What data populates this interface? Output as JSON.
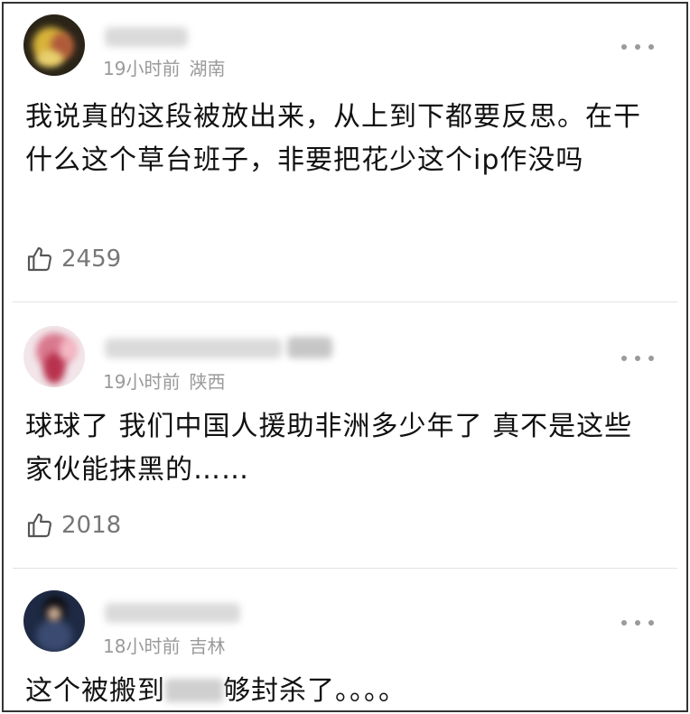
{
  "comments": [
    {
      "time": "19小时前",
      "location": "湖南",
      "text": "我说真的这段被放出来，从上到下都要反思。在干什么这个草台班子，非要把花少这个ip作没吗",
      "likes": "2459",
      "avatar_icon": "user-avatar-blurred",
      "more_icon": "more-dots-icon",
      "like_icon": "thumbs-up-icon"
    },
    {
      "time": "19小时前",
      "location": "陕西",
      "text": "球球了  我们中国人援助非洲多少年了 真不是这些家伙能抹黑的……",
      "likes": "2018",
      "avatar_icon": "user-avatar-blurred",
      "more_icon": "more-dots-icon",
      "like_icon": "thumbs-up-icon"
    },
    {
      "time": "18小时前",
      "location": "吉林",
      "text_before": "这个被搬到",
      "text_after": "够封杀了。。。。",
      "avatar_icon": "user-avatar-blurred",
      "more_icon": "more-dots-icon"
    }
  ],
  "colors": {
    "text": "#111111",
    "meta": "#9a9a9a",
    "likes": "#777777",
    "divider": "#e2e2e2",
    "border": "#333333"
  }
}
